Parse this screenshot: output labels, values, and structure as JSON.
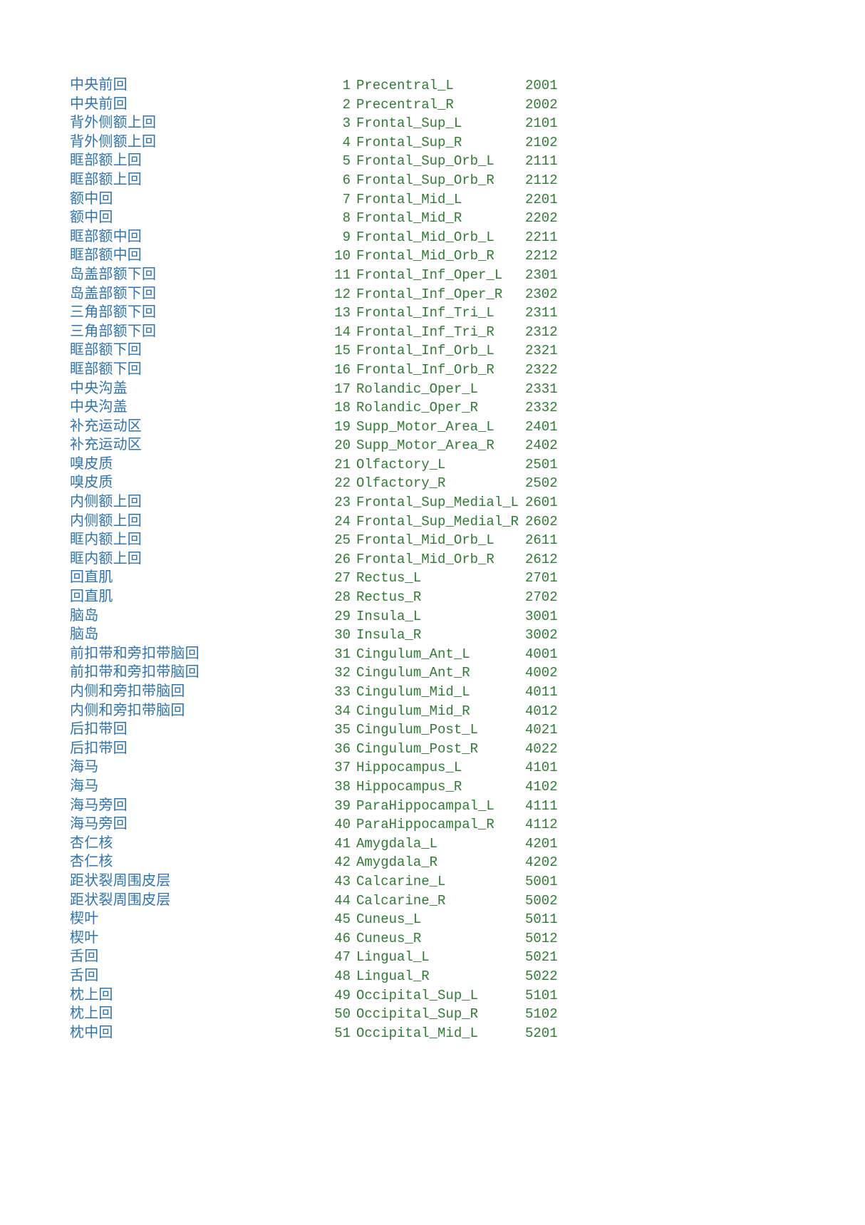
{
  "document": {
    "type": "brain-atlas-region-table",
    "colors": {
      "chinese_text": "#2E74B5",
      "latin_text": "#2E7D32",
      "background": "#FFFFFF"
    }
  },
  "rows": [
    {
      "cn": "中央前回",
      "idx": "1",
      "en": "Precentral_L",
      "code": "2001"
    },
    {
      "cn": "中央前回",
      "idx": "2",
      "en": "Precentral_R",
      "code": "2002"
    },
    {
      "cn": "背外侧额上回",
      "idx": "3",
      "en": "Frontal_Sup_L",
      "code": "2101"
    },
    {
      "cn": "背外侧额上回",
      "idx": "4",
      "en": "Frontal_Sup_R",
      "code": "2102"
    },
    {
      "cn": "眶部额上回",
      "idx": "5",
      "en": "Frontal_Sup_Orb_L",
      "code": "2111"
    },
    {
      "cn": "眶部额上回",
      "idx": "6",
      "en": "Frontal_Sup_Orb_R",
      "code": "2112"
    },
    {
      "cn": "额中回",
      "idx": "7",
      "en": "Frontal_Mid_L",
      "code": "2201"
    },
    {
      "cn": "额中回",
      "idx": "8",
      "en": "Frontal_Mid_R",
      "code": "2202"
    },
    {
      "cn": "眶部额中回",
      "idx": "9",
      "en": "Frontal_Mid_Orb_L",
      "code": "2211"
    },
    {
      "cn": "眶部额中回",
      "idx": "10",
      "en": "Frontal_Mid_Orb_R",
      "code": "2212"
    },
    {
      "cn": "岛盖部额下回",
      "idx": "11",
      "en": "Frontal_Inf_Oper_L",
      "code": "2301"
    },
    {
      "cn": "岛盖部额下回",
      "idx": "12",
      "en": "Frontal_Inf_Oper_R",
      "code": "2302"
    },
    {
      "cn": "三角部额下回",
      "idx": "13",
      "en": "Frontal_Inf_Tri_L",
      "code": "2311"
    },
    {
      "cn": "三角部额下回",
      "idx": "14",
      "en": "Frontal_Inf_Tri_R",
      "code": "2312"
    },
    {
      "cn": "眶部额下回",
      "idx": "15",
      "en": "Frontal_Inf_Orb_L",
      "code": "2321"
    },
    {
      "cn": "眶部额下回",
      "idx": "16",
      "en": "Frontal_Inf_Orb_R",
      "code": "2322"
    },
    {
      "cn": "中央沟盖",
      "idx": "17",
      "en": "Rolandic_Oper_L",
      "code": "2331"
    },
    {
      "cn": "中央沟盖",
      "idx": "18",
      "en": "Rolandic_Oper_R",
      "code": "2332"
    },
    {
      "cn": "补充运动区",
      "idx": "19",
      "en": "Supp_Motor_Area_L",
      "code": "2401"
    },
    {
      "cn": "补充运动区",
      "idx": "20",
      "en": "Supp_Motor_Area_R",
      "code": "2402"
    },
    {
      "cn": "嗅皮质",
      "idx": "21",
      "en": "Olfactory_L",
      "code": "2501"
    },
    {
      "cn": "嗅皮质",
      "idx": "22",
      "en": "Olfactory_R",
      "code": "2502"
    },
    {
      "cn": "内侧额上回",
      "idx": "23",
      "en": "Frontal_Sup_Medial_L",
      "code": "2601"
    },
    {
      "cn": "内侧额上回",
      "idx": "24",
      "en": "Frontal_Sup_Medial_R",
      "code": "2602"
    },
    {
      "cn": "眶内额上回",
      "idx": "25",
      "en": "Frontal_Mid_Orb_L",
      "code": "2611"
    },
    {
      "cn": "眶内额上回",
      "idx": "26",
      "en": "Frontal_Mid_Orb_R",
      "code": "2612"
    },
    {
      "cn": "回直肌",
      "idx": "27",
      "en": "Rectus_L",
      "code": "2701"
    },
    {
      "cn": "回直肌",
      "idx": "28",
      "en": "Rectus_R",
      "code": "2702"
    },
    {
      "cn": "脑岛",
      "idx": "29",
      "en": "Insula_L",
      "code": "3001"
    },
    {
      "cn": "脑岛",
      "idx": "30",
      "en": "Insula_R",
      "code": "3002"
    },
    {
      "cn": "前扣带和旁扣带脑回",
      "idx": "31",
      "en": "Cingulum_Ant_L",
      "code": "4001"
    },
    {
      "cn": "前扣带和旁扣带脑回",
      "idx": "32",
      "en": "Cingulum_Ant_R",
      "code": "4002"
    },
    {
      "cn": "内侧和旁扣带脑回",
      "idx": "33",
      "en": "Cingulum_Mid_L",
      "code": "4011"
    },
    {
      "cn": "内侧和旁扣带脑回",
      "idx": "34",
      "en": "Cingulum_Mid_R",
      "code": "4012"
    },
    {
      "cn": "后扣带回",
      "idx": "35",
      "en": "Cingulum_Post_L",
      "code": "4021"
    },
    {
      "cn": "后扣带回",
      "idx": "36",
      "en": "Cingulum_Post_R",
      "code": "4022"
    },
    {
      "cn": "海马",
      "idx": "37",
      "en": "Hippocampus_L",
      "code": "4101"
    },
    {
      "cn": "海马",
      "idx": "38",
      "en": "Hippocampus_R",
      "code": "4102"
    },
    {
      "cn": "海马旁回",
      "idx": "39",
      "en": "ParaHippocampal_L",
      "code": "4111"
    },
    {
      "cn": "海马旁回",
      "idx": "40",
      "en": "ParaHippocampal_R",
      "code": "4112"
    },
    {
      "cn": "杏仁核",
      "idx": "41",
      "en": "Amygdala_L",
      "code": "4201"
    },
    {
      "cn": "杏仁核",
      "idx": "42",
      "en": "Amygdala_R",
      "code": "4202"
    },
    {
      "cn": "距状裂周围皮层",
      "idx": "43",
      "en": "Calcarine_L",
      "code": "5001"
    },
    {
      "cn": "距状裂周围皮层",
      "idx": "44",
      "en": "Calcarine_R",
      "code": "5002"
    },
    {
      "cn": "楔叶",
      "idx": "45",
      "en": "Cuneus_L",
      "code": "5011"
    },
    {
      "cn": "楔叶",
      "idx": "46",
      "en": "Cuneus_R",
      "code": "5012"
    },
    {
      "cn": "舌回",
      "idx": "47",
      "en": "Lingual_L",
      "code": "5021"
    },
    {
      "cn": "舌回",
      "idx": "48",
      "en": "Lingual_R",
      "code": "5022"
    },
    {
      "cn": "枕上回",
      "idx": "49",
      "en": "Occipital_Sup_L",
      "code": "5101"
    },
    {
      "cn": "枕上回",
      "idx": "50",
      "en": "Occipital_Sup_R",
      "code": "5102"
    },
    {
      "cn": "枕中回",
      "idx": "51",
      "en": "Occipital_Mid_L",
      "code": "5201"
    }
  ]
}
